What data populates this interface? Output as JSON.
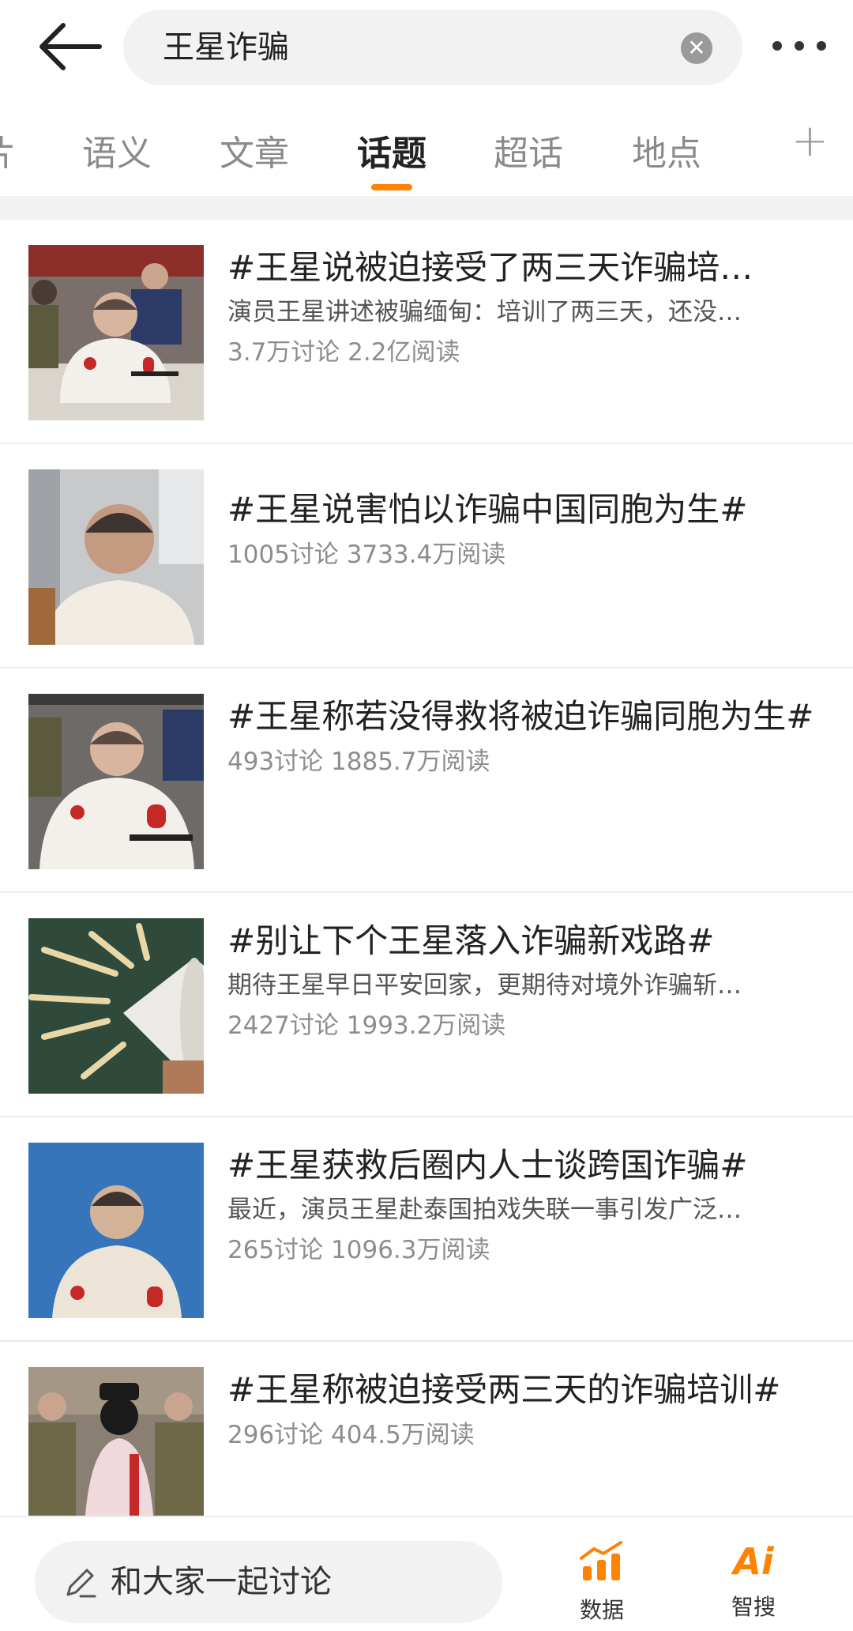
{
  "header": {
    "search_query": "王星诈骗",
    "back_icon": "arrow-left-icon",
    "clear_icon": "close-circle-icon",
    "more_icon": "more-horizontal-icon"
  },
  "tabs": [
    {
      "label": "片",
      "active": false
    },
    {
      "label": "语义",
      "active": false
    },
    {
      "label": "文章",
      "active": false
    },
    {
      "label": "话题",
      "active": true
    },
    {
      "label": "超话",
      "active": false
    },
    {
      "label": "地点",
      "active": false
    }
  ],
  "tab_add_label": "+",
  "accent_color": "#ff8200",
  "topics": [
    {
      "title": "#王星说被迫接受了两三天诈骗培…",
      "desc": "演员王星讲述被骗缅甸：培训了两三天，还没…",
      "stats": "3.7万讨论 2.2亿阅读"
    },
    {
      "title": "#王星说害怕以诈骗中国同胞为生#",
      "desc": "",
      "stats": "1005讨论 3733.4万阅读"
    },
    {
      "title": "#王星称若没得救将被迫诈骗同胞为生#",
      "desc": "",
      "stats": "493讨论 1885.7万阅读"
    },
    {
      "title": "#别让下个王星落入诈骗新戏路#",
      "desc": "期待王星早日平安回家，更期待对境外诈骗斩…",
      "stats": "2427讨论 1993.2万阅读"
    },
    {
      "title": "#王星获救后圈内人士谈跨国诈骗#",
      "desc": "最近，演员王星赴泰国拍戏失联一事引发广泛…",
      "stats": "265讨论 1096.3万阅读"
    },
    {
      "title": "#王星称被迫接受两三天的诈骗培训#",
      "desc": "",
      "stats": "296讨论 404.5万阅读"
    }
  ],
  "bottom_bar": {
    "compose_placeholder": "和大家一起讨论",
    "compose_icon": "pencil-icon",
    "data_label": "数据",
    "data_icon": "bar-chart-icon",
    "ai_label": "智搜",
    "ai_icon_text": "Ai"
  }
}
